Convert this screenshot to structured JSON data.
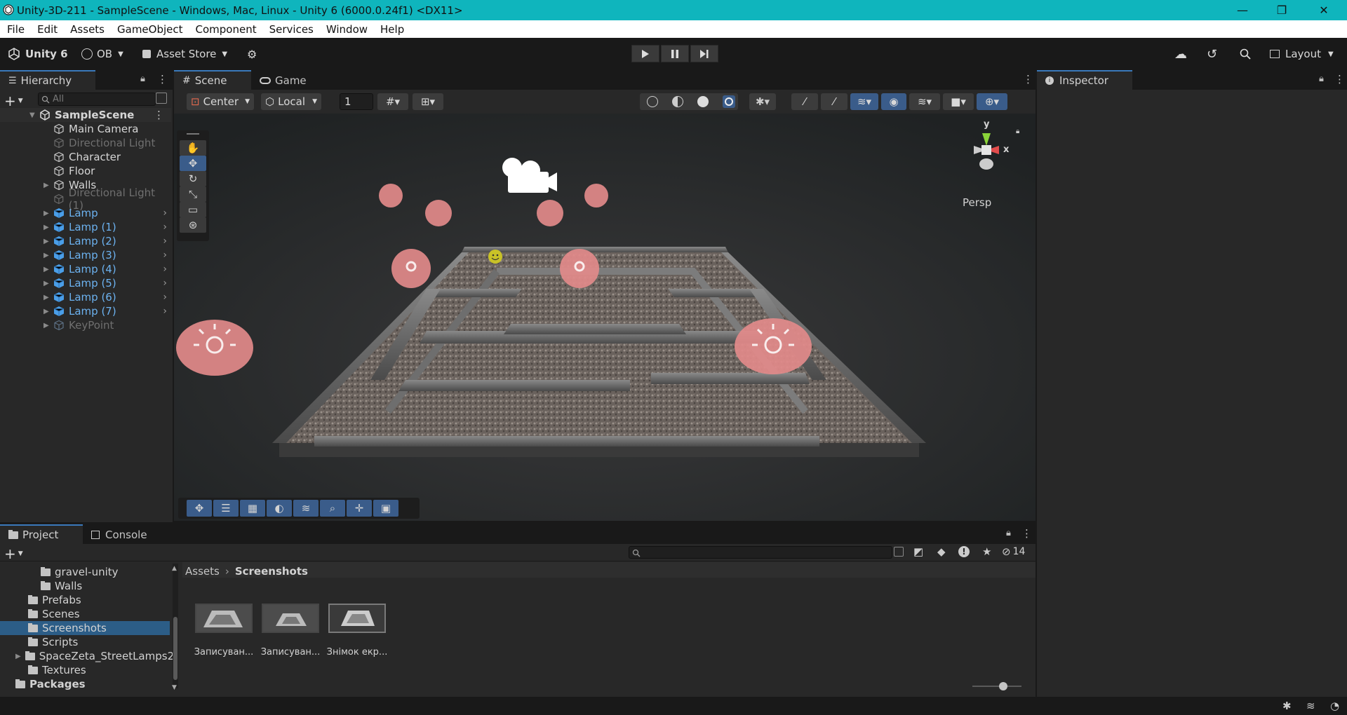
{
  "window": {
    "title": "Unity-3D-211 - SampleScene - Windows, Mac, Linux - Unity 6 (6000.0.24f1) <DX11>",
    "minimize": "—",
    "restore": "❐",
    "close": "✕"
  },
  "menu": [
    "File",
    "Edit",
    "Assets",
    "GameObject",
    "Component",
    "Services",
    "Window",
    "Help"
  ],
  "toolbar": {
    "unity_label": "Unity 6",
    "account": "OB",
    "asset_store": "Asset Store",
    "layout": "Layout"
  },
  "hierarchy": {
    "tab": "Hierarchy",
    "search_placeholder": "All",
    "scene": "SampleScene",
    "items": [
      {
        "label": "Main Camera",
        "state": "normal"
      },
      {
        "label": "Directional Light",
        "state": "dim"
      },
      {
        "label": "Character",
        "state": "normal"
      },
      {
        "label": "Floor",
        "state": "normal"
      },
      {
        "label": "Walls",
        "state": "normal"
      },
      {
        "label": "Directional Light (1)",
        "state": "dim"
      },
      {
        "label": "Lamp",
        "state": "blue"
      },
      {
        "label": "Lamp (1)",
        "state": "blue"
      },
      {
        "label": "Lamp (2)",
        "state": "blue"
      },
      {
        "label": "Lamp (3)",
        "state": "blue"
      },
      {
        "label": "Lamp (4)",
        "state": "blue"
      },
      {
        "label": "Lamp (5)",
        "state": "blue"
      },
      {
        "label": "Lamp (6)",
        "state": "blue"
      },
      {
        "label": "Lamp (7)",
        "state": "blue"
      },
      {
        "label": "KeyPoint",
        "state": "dim"
      }
    ]
  },
  "scene": {
    "tab_scene": "Scene",
    "tab_game": "Game",
    "pivot": "Center",
    "space": "Local",
    "snap": "1",
    "gizmo_y": "y",
    "gizmo_x": "x",
    "persp": "Persp"
  },
  "inspector": {
    "tab": "Inspector"
  },
  "project": {
    "tab_project": "Project",
    "tab_console": "Console",
    "tree": [
      {
        "label": "gravel-unity"
      },
      {
        "label": "Walls"
      },
      {
        "label": "Prefabs"
      },
      {
        "label": "Scenes"
      },
      {
        "label": "Screenshots"
      },
      {
        "label": "Scripts"
      },
      {
        "label": "SpaceZeta_StreetLamps2"
      },
      {
        "label": "Textures"
      },
      {
        "label": "Packages"
      }
    ],
    "breadcrumb_root": "Assets",
    "breadcrumb_current": "Screenshots",
    "assets": [
      "Записуван...",
      "Записуван...",
      "Знімок екр..."
    ],
    "hidden_count": "14"
  }
}
